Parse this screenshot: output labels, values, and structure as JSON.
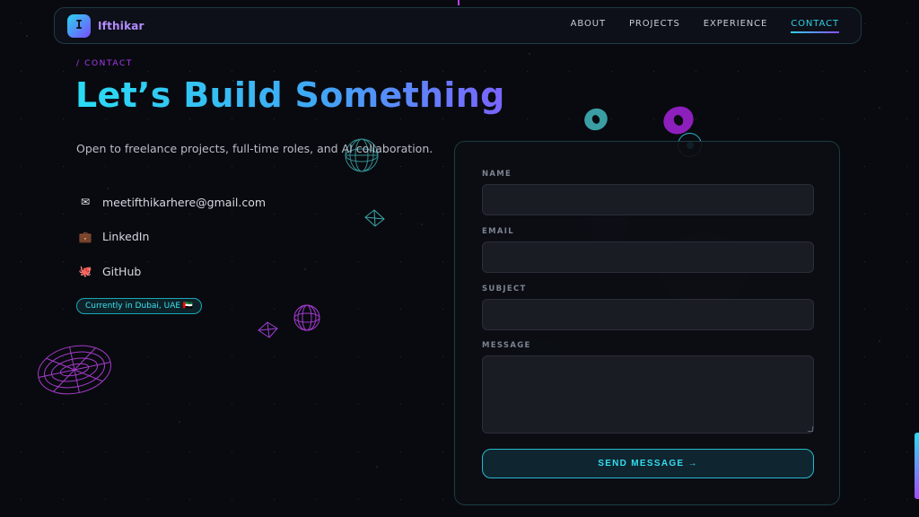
{
  "nav": {
    "logo_letter": "I",
    "brand": "Ifthikar",
    "links": [
      {
        "label": "ABOUT"
      },
      {
        "label": "PROJECTS"
      },
      {
        "label": "EXPERIENCE"
      },
      {
        "label": "CONTACT",
        "active": true
      }
    ]
  },
  "hero": {
    "eyebrow": "/ CONTACT",
    "title": "Let’s Build Something",
    "subtitle": "Open to freelance projects, full-time roles, and AI collaboration."
  },
  "contacts": [
    {
      "icon": "envelope-icon",
      "glyph": "✉",
      "text": "meetifthikarhere@gmail.com"
    },
    {
      "icon": "briefcase-icon",
      "glyph": "💼",
      "text": "LinkedIn"
    },
    {
      "icon": "octopus-icon",
      "glyph": "🐙",
      "text": "GitHub"
    }
  ],
  "location_badge": "Currently in Dubai, UAE 🇦🇪",
  "form": {
    "name_label": "NAME",
    "email_label": "EMAIL",
    "subject_label": "SUBJECT",
    "message_label": "MESSAGE",
    "name_value": "",
    "email_value": "",
    "subject_value": "",
    "message_value": "",
    "submit_label": "SEND MESSAGE →"
  },
  "colors": {
    "background": "#090a0f",
    "accent_cyan": "#2fd0e8",
    "accent_purple": "#a53df0"
  }
}
